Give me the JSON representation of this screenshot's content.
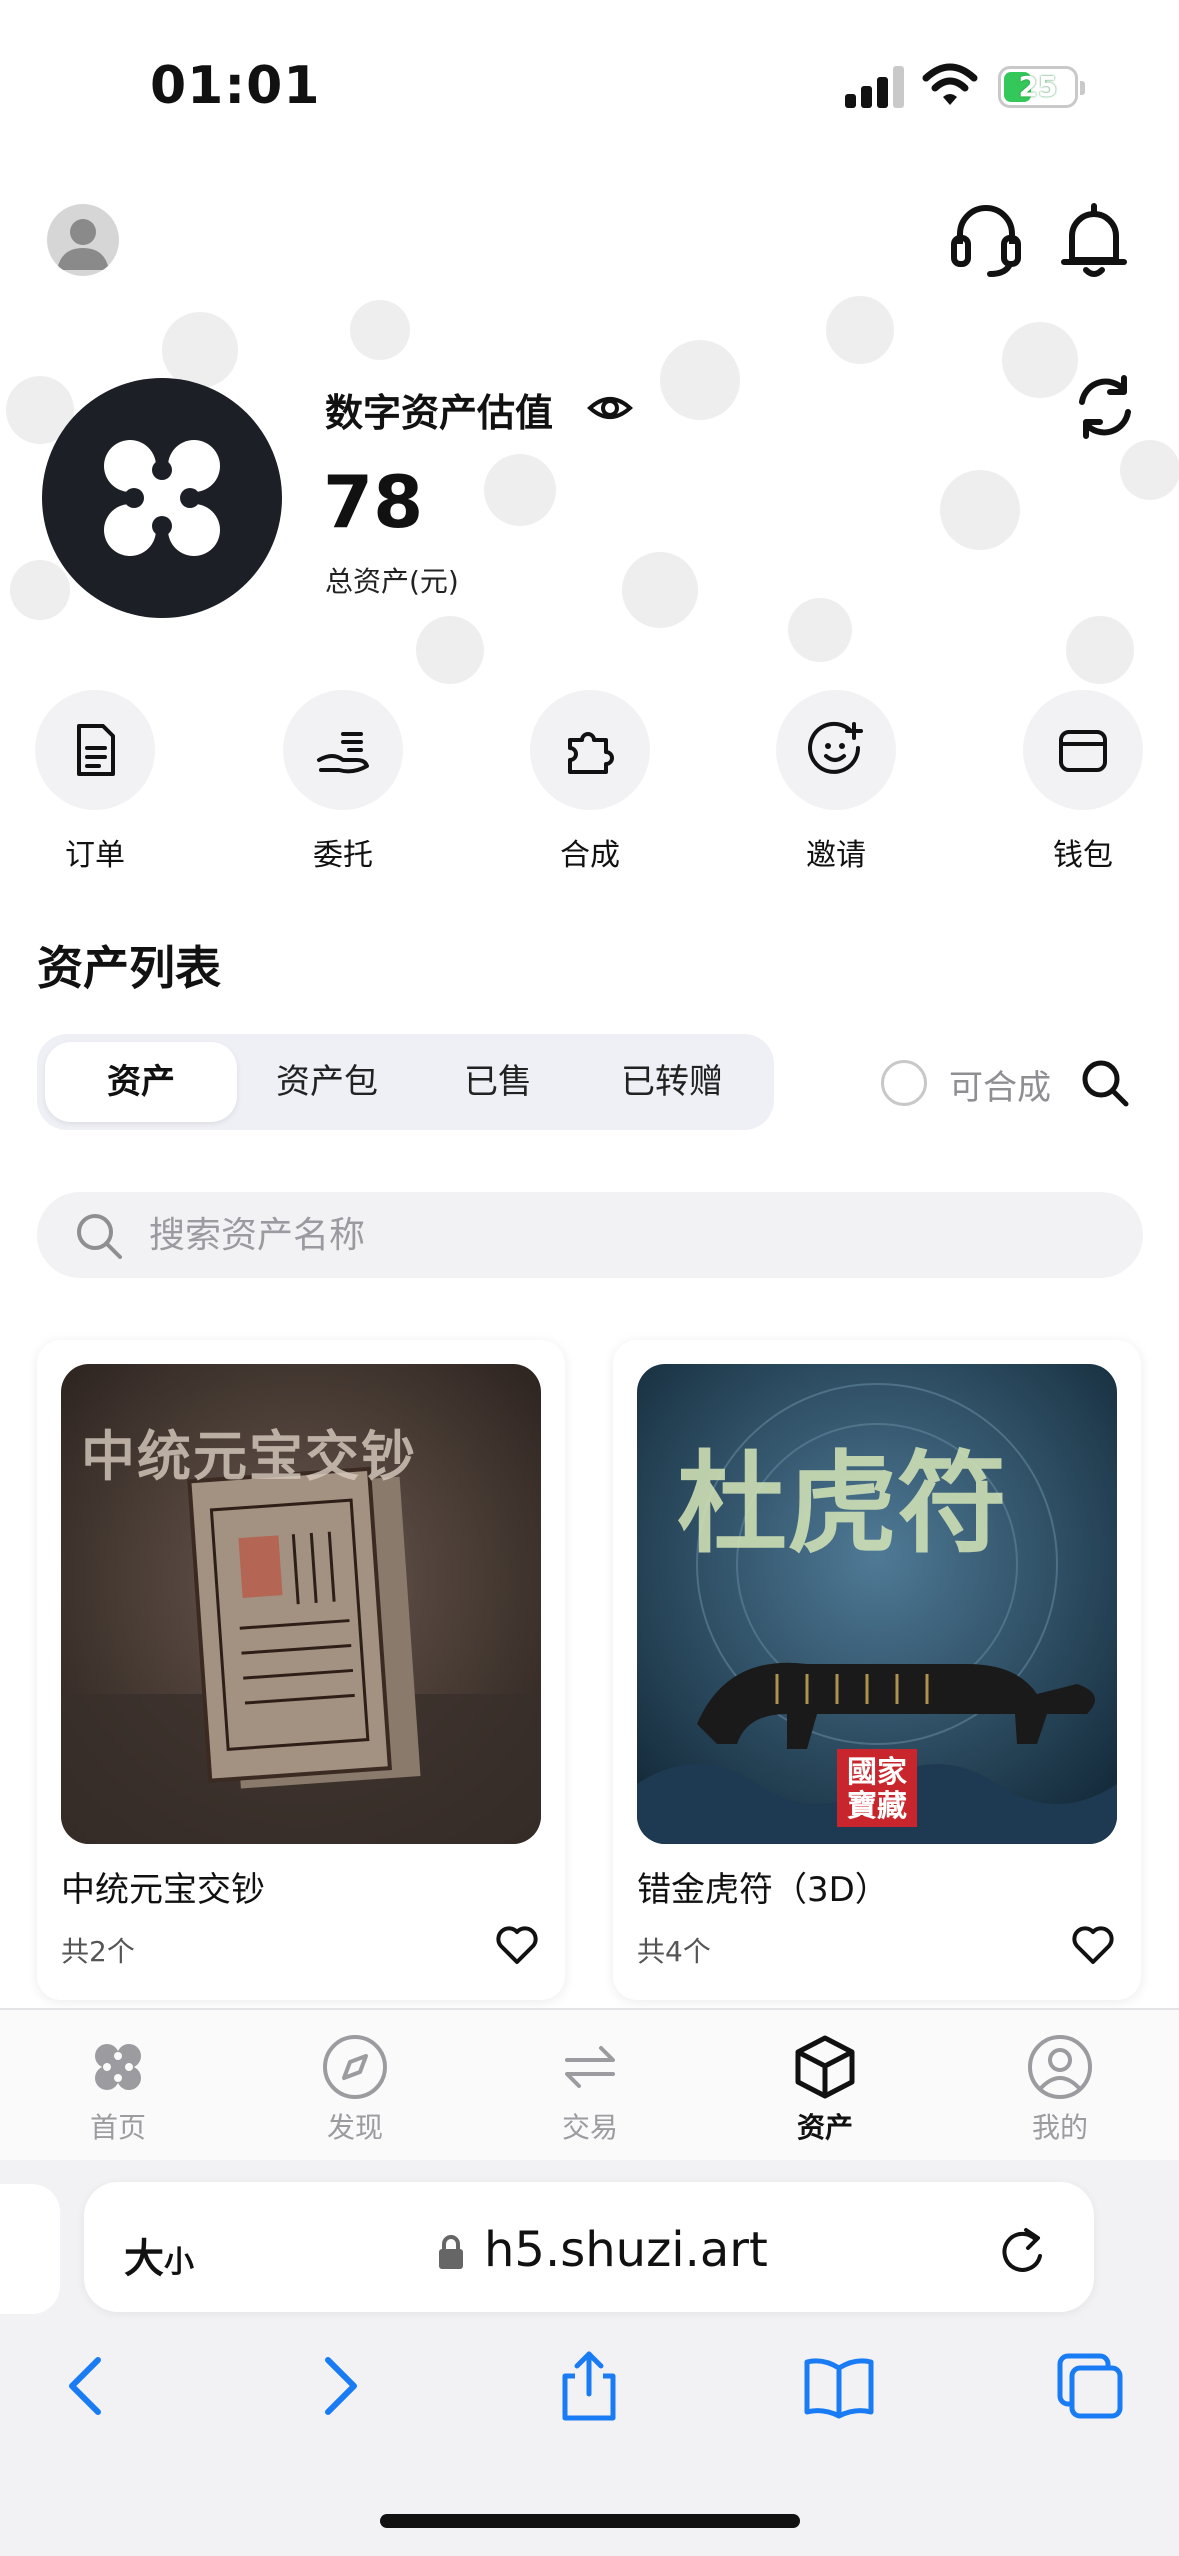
{
  "status_bar": {
    "time": "01:01",
    "battery": "25"
  },
  "header": {
    "avatar_icon": "user-avatar-icon",
    "support_icon": "headset-icon",
    "notify_icon": "bell-icon"
  },
  "hero": {
    "valuation_label": "数字资产估值",
    "valuation_value": "78",
    "valuation_sub": "总资产(元)",
    "visibility_icon": "eye-icon",
    "refresh_icon": "refresh-icon"
  },
  "quick_actions": [
    {
      "label": "订单",
      "icon": "document-icon"
    },
    {
      "label": "委托",
      "icon": "hand-coin-icon"
    },
    {
      "label": "合成",
      "icon": "puzzle-icon"
    },
    {
      "label": "邀请",
      "icon": "smile-plus-icon"
    },
    {
      "label": "钱包",
      "icon": "wallet-icon"
    }
  ],
  "asset_list": {
    "title": "资产列表",
    "tabs": [
      "资产",
      "资产包",
      "已售",
      "已转赠"
    ],
    "active_tab": "资产",
    "combinable_label": "可合成",
    "search_placeholder": "搜索资产名称"
  },
  "cards": [
    {
      "name": "中统元宝交钞",
      "count": "共2个",
      "image_text": "中统元宝交钞"
    },
    {
      "name": "错金虎符（3D）",
      "count": "共4个",
      "image_text": "杜虎符",
      "seal_text": "國家寶藏"
    }
  ],
  "tab_bar": [
    {
      "label": "首页",
      "icon": "home-logo-icon"
    },
    {
      "label": "发现",
      "icon": "compass-icon"
    },
    {
      "label": "交易",
      "icon": "exchange-arrows-icon"
    },
    {
      "label": "资产",
      "icon": "box-icon"
    },
    {
      "label": "我的",
      "icon": "profile-icon"
    }
  ],
  "active_bottom_tab": "资产",
  "browser": {
    "size_big": "大",
    "size_small": "小",
    "url": "h5.shuzi.art"
  }
}
